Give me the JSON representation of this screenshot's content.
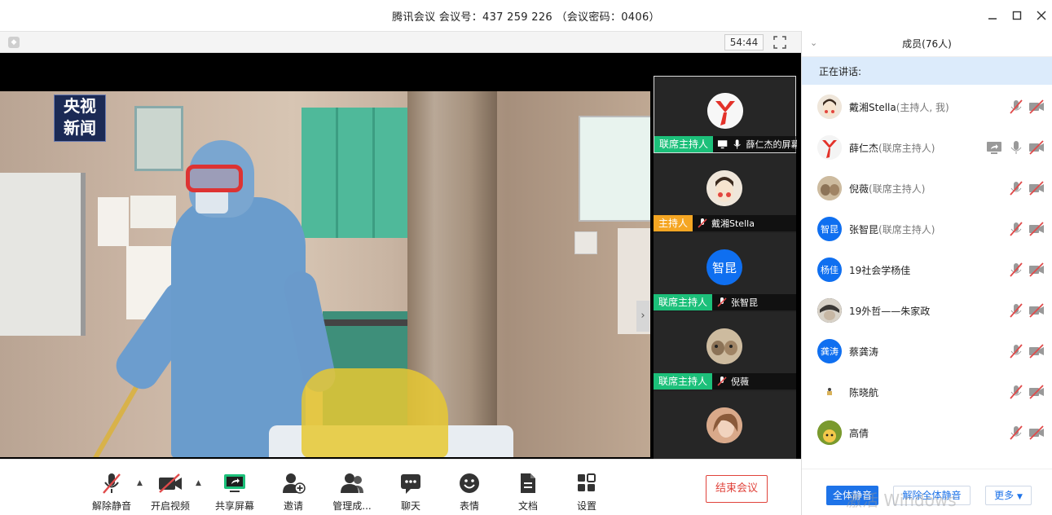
{
  "window": {
    "title": "腾讯会议 会议号：437 259 226 （会议密码：0406）",
    "controls": [
      "minimize",
      "maximize",
      "close"
    ]
  },
  "video_area": {
    "timer": "54:44",
    "overlay_logo": [
      "央视",
      "新闻"
    ]
  },
  "thumbnails": [
    {
      "role": "联席主持人",
      "role_color": "#1cc07a",
      "name": "薛仁杰的屏幕",
      "screen_share": true,
      "mic": "on",
      "active": true
    },
    {
      "role": "主持人",
      "role_color": "#f5a623",
      "name": "戴湘Stella",
      "mic": "muted",
      "active": false
    },
    {
      "role": "联席主持人",
      "role_color": "#1cc07a",
      "name": "张智昆",
      "avatar_text": "智昆",
      "mic": "muted",
      "active": false
    },
    {
      "role": "联席主持人",
      "role_color": "#1cc07a",
      "name": "倪薇",
      "mic": "muted",
      "active": false
    },
    {
      "role": "",
      "role_color": "",
      "name": "",
      "mic": "",
      "active": false
    }
  ],
  "toolbar": {
    "items": [
      {
        "label": "解除静音",
        "icon": "mic-muted-icon"
      },
      {
        "label": "开启视频",
        "icon": "camera-off-icon"
      },
      {
        "label": "共享屏幕",
        "icon": "share-screen-icon"
      },
      {
        "label": "邀请",
        "icon": "add-user-icon"
      },
      {
        "label": "管理成...",
        "icon": "members-icon"
      },
      {
        "label": "聊天",
        "icon": "chat-icon"
      },
      {
        "label": "表情",
        "icon": "emoji-icon"
      },
      {
        "label": "文档",
        "icon": "document-icon"
      },
      {
        "label": "设置",
        "icon": "settings-icon"
      }
    ],
    "end_meeting": "结束会议"
  },
  "members_panel": {
    "header": "成员(76人)",
    "speaking_label": "正在讲话:",
    "members": [
      {
        "name": "戴湘Stella",
        "tag": "(主持人, 我)",
        "avatar_text": "",
        "avatar_color": "#f2e6d8",
        "screen": false
      },
      {
        "name": "薛仁杰",
        "tag": "(联席主持人)",
        "avatar_text": "",
        "avatar_color": "#f3f3f3",
        "screen": true
      },
      {
        "name": "倪薇",
        "tag": "(联席主持人)",
        "avatar_text": "",
        "avatar_color": "#c9b8a1",
        "screen": false
      },
      {
        "name": "张智昆",
        "tag": "(联席主持人)",
        "avatar_text": "智昆",
        "avatar_color": "#0f6ff0",
        "screen": false
      },
      {
        "name": "19社会学杨佳",
        "tag": "",
        "avatar_text": "杨佳",
        "avatar_color": "#0f6ff0",
        "screen": false
      },
      {
        "name": "19外哲——朱家政",
        "tag": "",
        "avatar_text": "",
        "avatar_color": "#5a5550",
        "screen": false
      },
      {
        "name": "蔡龚涛",
        "tag": "",
        "avatar_text": "龚涛",
        "avatar_color": "#0f6ff0",
        "screen": false
      },
      {
        "name": "陈晓航",
        "tag": "",
        "avatar_text": "",
        "avatar_color": "#ffffff",
        "screen": false
      },
      {
        "name": "高倩",
        "tag": "",
        "avatar_text": "",
        "avatar_color": "#6b8e23",
        "screen": false
      },
      {
        "name": "",
        "tag": "",
        "avatar_text": "",
        "avatar_color": "#0f6ff0",
        "screen": false
      }
    ],
    "buttons": {
      "mute_all": "全体静音",
      "unmute_all": "解除全体静音",
      "more": "更多"
    }
  },
  "system_watermark": "激活 Windows",
  "colors": {
    "accent_blue": "#1e73e8",
    "end_red": "#e0433b",
    "muted_red": "#e04a4a",
    "speaking_bg": "#dcebfb"
  }
}
